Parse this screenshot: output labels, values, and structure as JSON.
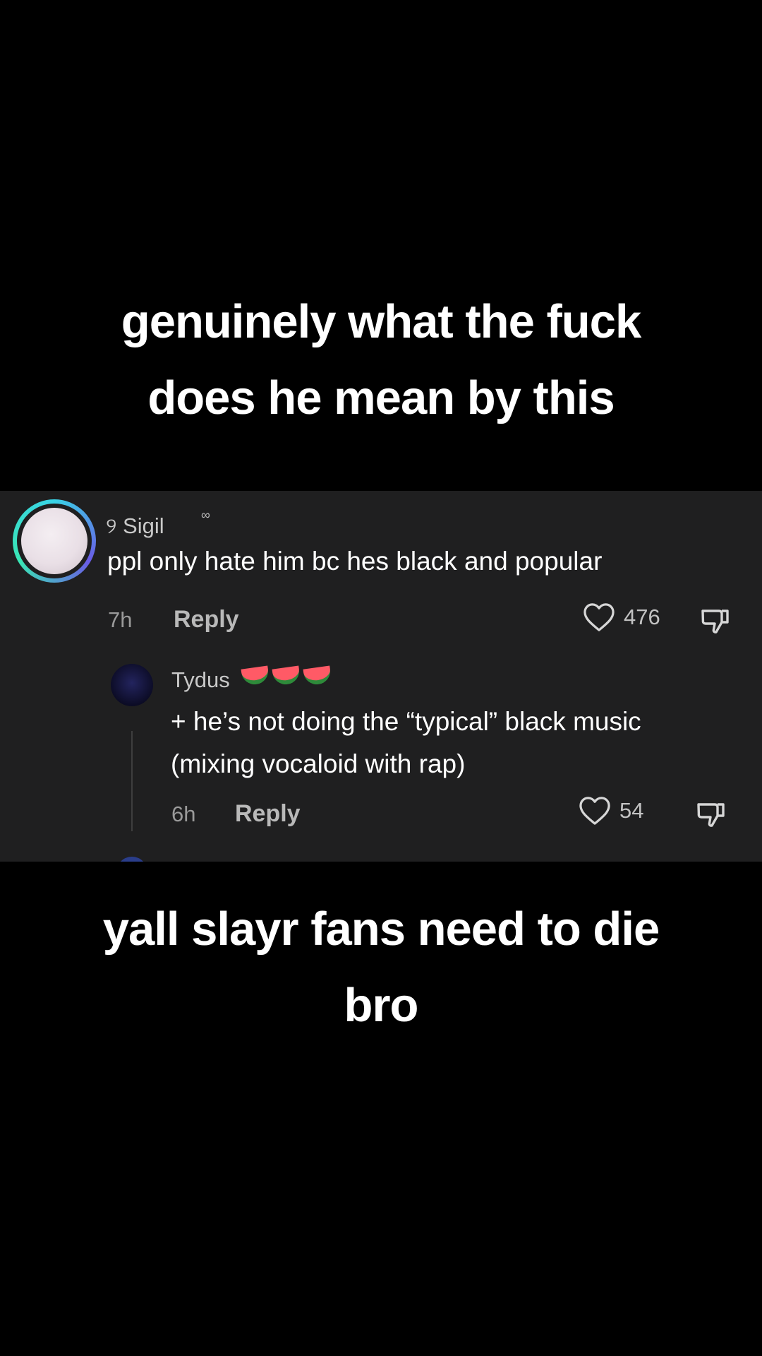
{
  "caption_top": {
    "line1": "genuinely what the fuck",
    "line2": "does he mean by this"
  },
  "caption_bottom": {
    "line1": "yall slayr fans need to die",
    "line2": "bro"
  },
  "comment": {
    "username": "୨ Sigil",
    "badge": "∞",
    "text": "ppl only hate him bc hes black and popular",
    "time": "7h",
    "reply_label": "Reply",
    "likes": "476",
    "avatar_icon": "profile-avatar"
  },
  "reply": {
    "username": "Tydus",
    "emoji": "watermelon x3",
    "text": "+ he’s not doing the “typical” black music (mixing vocaloid with rap)",
    "time": "6h",
    "reply_label": "Reply",
    "likes": "54"
  },
  "colors": {
    "background": "#000000",
    "comment_panel": "#1f1f20",
    "avatar_ring": "#39d3e6",
    "muted_text": "#9a9a9a"
  }
}
